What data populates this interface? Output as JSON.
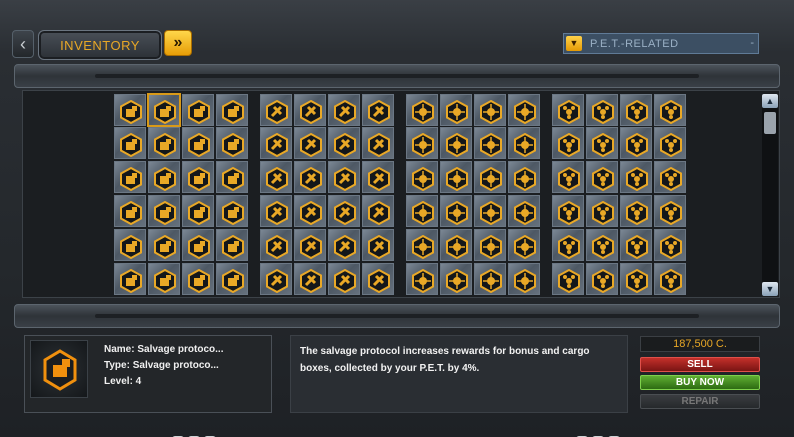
{
  "header": {
    "inventory_tab": "INVENTORY",
    "filter_value": "P.E.T.-RELATED",
    "filter_end": "-"
  },
  "grid": {
    "groups": [
      {
        "color": "#f08a10",
        "glyph": "module-a-icon",
        "cols": 4
      },
      {
        "color": "#f08a10",
        "glyph": "module-b-icon",
        "cols": 4
      },
      {
        "color": "#f08a10",
        "glyph": "module-c-icon",
        "cols": 4
      },
      {
        "color": "#f08a10",
        "glyph": "pet-gear-icon",
        "cols": 4
      }
    ],
    "selected": "0-1"
  },
  "details": {
    "name": "Name: Salvage protoco...",
    "type": "Type: Salvage protoco...",
    "level": "Level: 4",
    "description": "The salvage protocol increases rewards for bonus and cargo boxes, collected by your P.E.T. by 4%."
  },
  "shop": {
    "price": "187,500 C.",
    "sell_label": "SELL",
    "buy_label": "BUY NOW",
    "repair_label": "REPAIR"
  },
  "colors": {
    "accent": "#e9a826",
    "sell": "#c4302b",
    "buy": "#5fae32"
  }
}
